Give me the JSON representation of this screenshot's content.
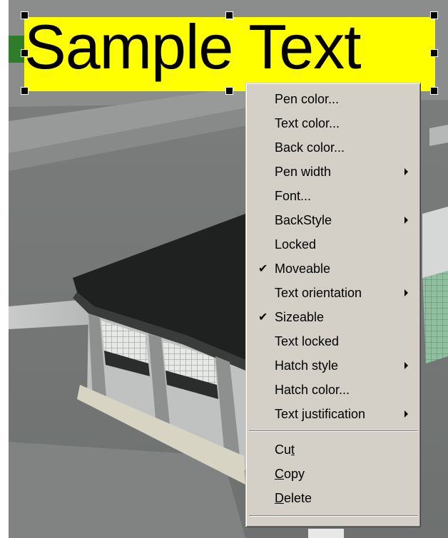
{
  "annotation": {
    "text": "Sample Text",
    "background_color": "#ffff00",
    "text_color": "#000000"
  },
  "context_menu": {
    "items": [
      {
        "label": "Pen color...",
        "submenu": false,
        "checked": false
      },
      {
        "label": "Text color...",
        "submenu": false,
        "checked": false
      },
      {
        "label": "Back color...",
        "submenu": false,
        "checked": false
      },
      {
        "label": "Pen width",
        "submenu": true,
        "checked": false
      },
      {
        "label": "Font...",
        "submenu": false,
        "checked": false
      },
      {
        "label": "BackStyle",
        "submenu": true,
        "checked": false
      },
      {
        "label": "Locked",
        "submenu": false,
        "checked": false
      },
      {
        "label": "Moveable",
        "submenu": false,
        "checked": true
      },
      {
        "label": "Text orientation",
        "submenu": true,
        "checked": false
      },
      {
        "label": "Sizeable",
        "submenu": false,
        "checked": true
      },
      {
        "label": "Text locked",
        "submenu": false,
        "checked": false
      },
      {
        "label": "Hatch style",
        "submenu": true,
        "checked": false
      },
      {
        "label": "Hatch color...",
        "submenu": false,
        "checked": false
      },
      {
        "label": "Text justification",
        "submenu": true,
        "checked": false
      }
    ],
    "edit_items": [
      {
        "pre": "Cu",
        "mnemonic": "t",
        "post": ""
      },
      {
        "pre": "",
        "mnemonic": "C",
        "post": "opy"
      },
      {
        "pre": "",
        "mnemonic": "D",
        "post": "elete"
      }
    ],
    "check_glyph": "✔",
    "menu_color": "#d4d0c8"
  }
}
